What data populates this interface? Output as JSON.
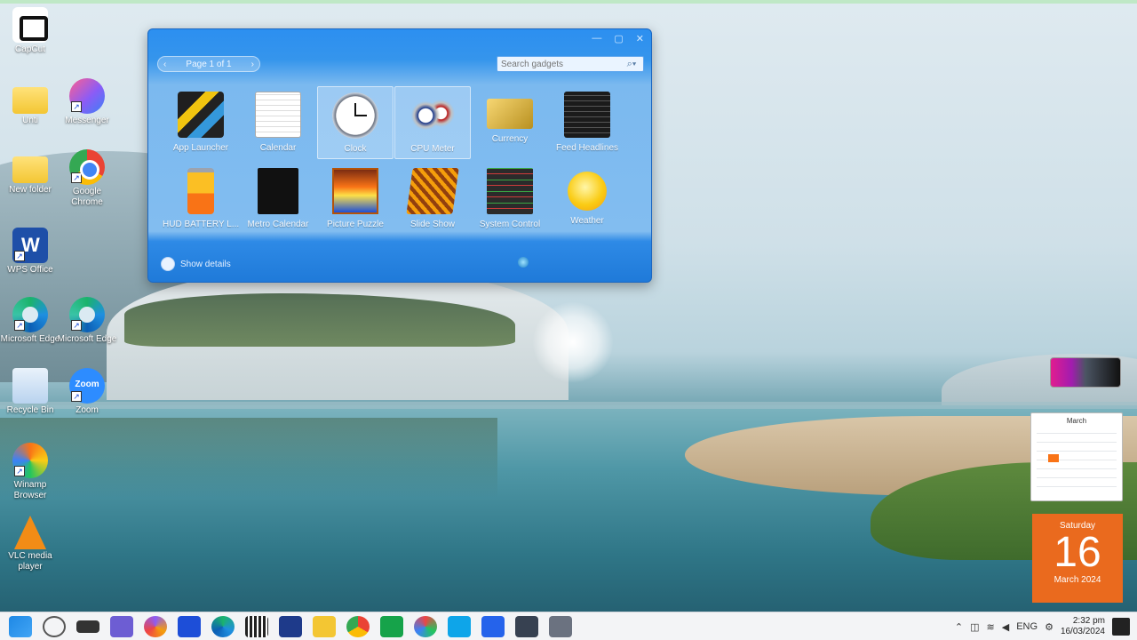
{
  "desktop_icons": [
    {
      "label": "CapCut",
      "icon": "capcut-icon"
    },
    {
      "label": "Unti",
      "icon": "folder-icon"
    },
    {
      "label": "Messenger",
      "icon": "messenger-icon"
    },
    {
      "label": "New folder",
      "icon": "folder-icon"
    },
    {
      "label": "Google Chrome",
      "icon": "chrome-icon"
    },
    {
      "label": "WPS Office",
      "icon": "word-icon"
    },
    {
      "label": "Microsoft Edge",
      "icon": "edge-icon"
    },
    {
      "label": "Microsoft Edge",
      "icon": "edge-icon"
    },
    {
      "label": "Recycle Bin",
      "icon": "recycle-bin-icon"
    },
    {
      "label": "Zoom",
      "icon": "zoom-icon"
    },
    {
      "label": "Winamp Browser",
      "icon": "winamp-icon"
    },
    {
      "label": "VLC media player",
      "icon": "vlc-icon"
    }
  ],
  "gadget_window": {
    "pager": "Page 1 of 1",
    "search_placeholder": "Search gadgets",
    "gadgets": [
      {
        "label": "App Launcher"
      },
      {
        "label": "Calendar"
      },
      {
        "label": "Clock"
      },
      {
        "label": "CPU Meter"
      },
      {
        "label": "Currency"
      },
      {
        "label": "Feed Headlines"
      },
      {
        "label": "HUD BATTERY L..."
      },
      {
        "label": "Metro Calendar"
      },
      {
        "label": "Picture Puzzle"
      },
      {
        "label": "Slide Show"
      },
      {
        "label": "System Control"
      },
      {
        "label": "Weather"
      }
    ],
    "footer_link": "Show details",
    "controls": {
      "minimize": "—",
      "maximize": "▢",
      "close": "✕"
    }
  },
  "date_tile": {
    "weekday": "Saturday",
    "day": "16",
    "month": "March 2024"
  },
  "mini_calendar": {
    "month": "March"
  },
  "tray": {
    "language": "ENG",
    "time": "2:32 pm",
    "date": "16/03/2024"
  },
  "colors": {
    "accent": "#2c8ff0",
    "date_tile": "#ea6a1e"
  }
}
